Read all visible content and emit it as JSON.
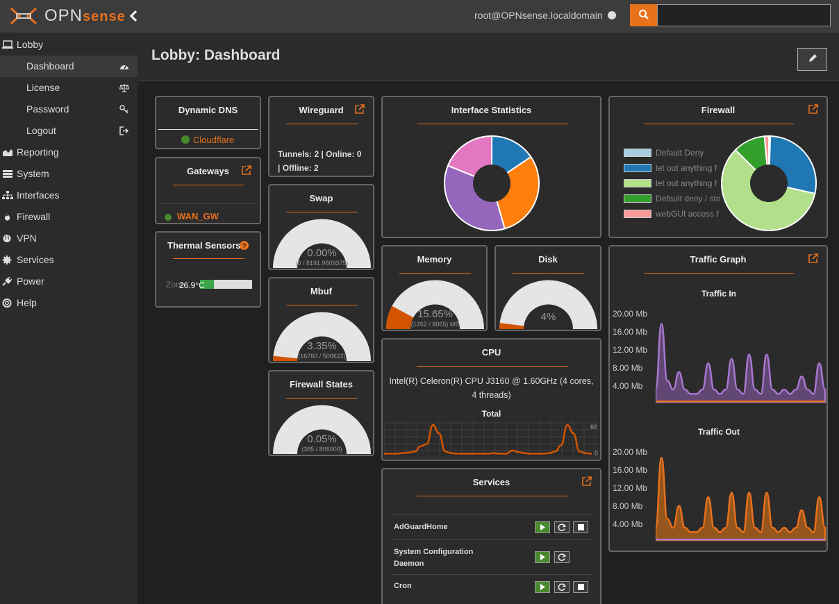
{
  "app": {
    "logo_text": "OPN",
    "logo_brand": "sense",
    "user": "root@OPNsense.localdomain",
    "search_placeholder": "",
    "page_title": "Lobby: Dashboard",
    "colors": {
      "accent": "#e8711c",
      "background": "#202020",
      "sidebar": "#2b2b2b",
      "ok": "#4a8a2e"
    }
  },
  "sidebar": {
    "items": [
      {
        "label": "Lobby",
        "icon": "laptop-icon"
      },
      {
        "label": "Dashboard",
        "icon": "dashboard-icon"
      },
      {
        "label": "License",
        "icon": "balance-scale-icon"
      },
      {
        "label": "Password",
        "icon": "key-icon"
      },
      {
        "label": "Logout",
        "icon": "sign-out-icon"
      },
      {
        "label": "Reporting",
        "icon": "area-chart-icon"
      },
      {
        "label": "System",
        "icon": "server-icon"
      },
      {
        "label": "Interfaces",
        "icon": "sitemap-icon"
      },
      {
        "label": "Firewall",
        "icon": "fire-icon"
      },
      {
        "label": "VPN",
        "icon": "globe-icon"
      },
      {
        "label": "Services",
        "icon": "cog-icon"
      },
      {
        "label": "Power",
        "icon": "plug-icon"
      },
      {
        "label": "Help",
        "icon": "support-icon"
      }
    ]
  },
  "widgets": {
    "dynamic_dns": {
      "title": "Dynamic DNS",
      "provider": "Cloudflare"
    },
    "gateways": {
      "title": "Gateways",
      "gateway": "WAN_GW"
    },
    "thermal": {
      "title": "Thermal Sensors",
      "zone": "Zone",
      "temp": "26.9°C",
      "level": 0.26
    },
    "wireguard": {
      "title": "Wireguard",
      "line1": "Tunnels: 2 | Online: 0",
      "line2": "| Offline: 2"
    },
    "swap": {
      "title": "Swap",
      "percent": "0.00%",
      "detail": "(0 / 8191.9609375)",
      "fraction": 0.0
    },
    "mbuf": {
      "title": "Mbuf",
      "percent": "3.35%",
      "detail": "(16760 / 500622)",
      "fraction": 0.0335
    },
    "fw_states": {
      "title": "Firewall States",
      "percent": "0.05%",
      "detail": "(385 / 806000)",
      "fraction": 0.0005
    },
    "iface_stats": {
      "title": "Interface Statistics"
    },
    "memory": {
      "title": "Memory",
      "percent": "15.65%",
      "detail": "(1262 / 8065) MB",
      "fraction": 0.1565
    },
    "disk": {
      "title": "Disk",
      "percent": "4%",
      "fraction": 0.04
    },
    "cpu": {
      "title": "CPU",
      "model": "Intel(R) Celeron(R) CPU J3160 @ 1.60GHz (4 cores, 4 threads)",
      "graph_title": "Total",
      "y_top": "60",
      "y_bottom": "0"
    },
    "services": {
      "title": "Services",
      "rows": [
        {
          "name": "AdGuardHome",
          "stop": true
        },
        {
          "name": "System Configuration Daemon",
          "stop": false
        },
        {
          "name": "Cron",
          "stop": true
        }
      ]
    },
    "firewall": {
      "title": "Firewall",
      "legend": [
        {
          "label": "Default Deny",
          "color": "#a6cee3"
        },
        {
          "label": "let out anything f",
          "color": "#1f78b4"
        },
        {
          "label": "let out anything f",
          "color": "#b2df8a"
        },
        {
          "label": "Default deny / sta",
          "color": "#33a02c"
        },
        {
          "label": "webGUI access f",
          "color": "#fb9a99"
        }
      ]
    },
    "traffic": {
      "title": "Traffic Graph",
      "in_title": "Traffic In",
      "out_title": "Traffic Out",
      "yticks": [
        "20.00 Mb",
        "16.00 Mb",
        "12.00 Mb",
        "8.00 Mb",
        "4.00 Mb"
      ]
    }
  },
  "chart_data": [
    {
      "type": "pie",
      "title": "Interface Statistics",
      "values": [
        0.14,
        0.27,
        0.32,
        0.17
      ],
      "colors": [
        "#1f77b4",
        "#ff7f0e",
        "#9467bd",
        "#e377c2"
      ]
    },
    {
      "type": "pie",
      "title": "Firewall",
      "categories": [
        "Default Deny",
        "let out anything f",
        "let out anything f",
        "Default deny / sta",
        "webGUI access f"
      ],
      "values": [
        0.005,
        0.28,
        0.59,
        0.11,
        0.015
      ],
      "colors": [
        "#a6cee3",
        "#1f78b4",
        "#b2df8a",
        "#33a02c",
        "#fb9a99"
      ]
    },
    {
      "type": "line",
      "title": "Total",
      "ylim": [
        0,
        60
      ],
      "y": [
        2,
        2,
        2,
        3,
        4,
        6,
        16,
        20,
        56,
        40,
        6,
        3,
        2,
        2,
        2,
        2,
        2,
        2,
        3,
        2,
        2,
        8,
        5,
        3,
        2,
        2,
        2,
        3,
        6,
        18,
        56,
        40,
        6,
        3,
        2
      ]
    },
    {
      "type": "area",
      "title": "Traffic In",
      "ylim": [
        0,
        20
      ],
      "series": [
        {
          "values": [
            3,
            18,
            5,
            3,
            7,
            3,
            2,
            2,
            3,
            9,
            3,
            2,
            3,
            10,
            3,
            2,
            11,
            3,
            2,
            11,
            3,
            2,
            3,
            2,
            3,
            6,
            3,
            2,
            9,
            3
          ]
        },
        {
          "values": [
            0.3,
            0.3,
            0.3,
            0.3,
            0.3,
            0.3,
            0.3,
            0.3,
            0.3,
            0.3,
            0.3,
            0.3,
            0.3,
            0.3,
            0.3,
            0.3,
            0.3,
            0.3,
            0.3,
            0.3,
            0.3,
            0.3,
            0.3,
            0.3,
            0.3,
            0.3,
            0.3,
            0.3,
            0.3,
            0.3
          ]
        }
      ]
    },
    {
      "type": "area",
      "title": "Traffic Out",
      "ylim": [
        0,
        20
      ],
      "series": [
        {
          "values": [
            3,
            19,
            5,
            3,
            8,
            3,
            2,
            2,
            3,
            10,
            3,
            2,
            3,
            11,
            3,
            2,
            11,
            3,
            2,
            11,
            3,
            2,
            3,
            2,
            3,
            7,
            3,
            2,
            10,
            3
          ]
        },
        {
          "values": [
            0.3,
            0.3,
            0.3,
            0.3,
            0.3,
            0.3,
            0.3,
            0.3,
            0.3,
            0.3,
            0.3,
            0.3,
            0.3,
            0.3,
            0.3,
            0.3,
            0.3,
            0.3,
            0.3,
            0.3,
            0.3,
            0.3,
            0.3,
            0.3,
            0.3,
            0.3,
            0.3,
            0.3,
            0.3,
            0.3
          ]
        }
      ]
    }
  ]
}
